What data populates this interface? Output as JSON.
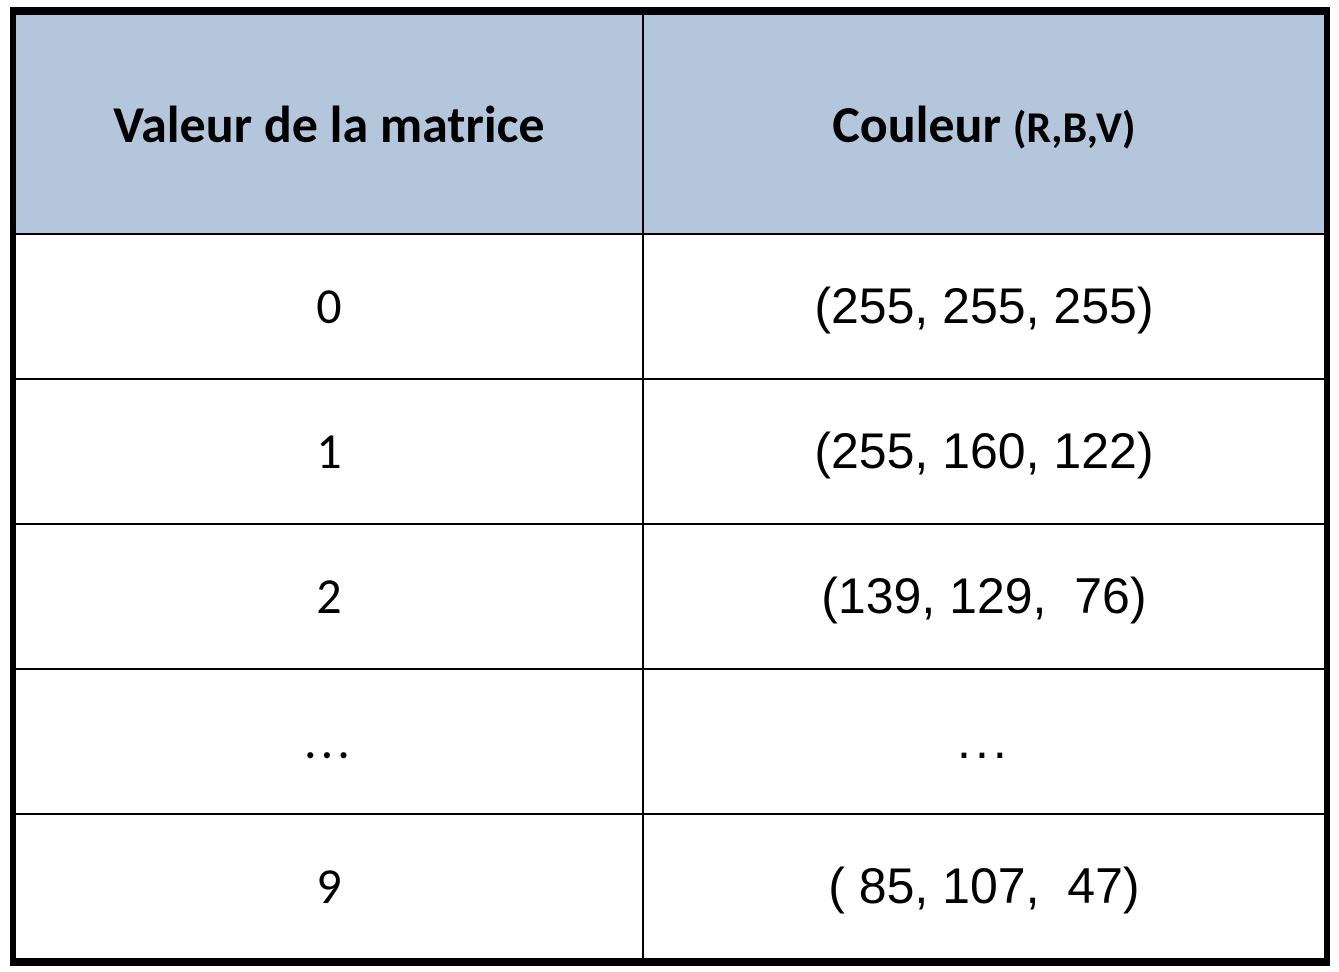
{
  "table": {
    "headers": {
      "col1": "Valeur de la matrice",
      "col2_main": "Couleur ",
      "col2_sub": "(R,B,V)"
    },
    "rows": [
      {
        "matrix_value": "0",
        "color": "(255, 255, 255)"
      },
      {
        "matrix_value": "1",
        "color": "(255, 160, 122)"
      },
      {
        "matrix_value": "2",
        "color": "(139, 129,  76)"
      },
      {
        "matrix_value": "...",
        "color": "..."
      },
      {
        "matrix_value": "9",
        "color": "( 85, 107,  47)"
      }
    ]
  }
}
